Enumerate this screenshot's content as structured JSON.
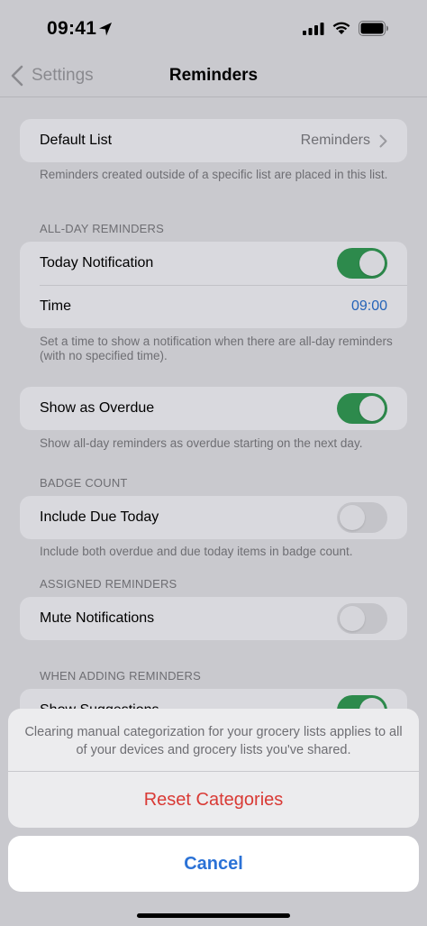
{
  "status_bar": {
    "time": "09:41"
  },
  "nav": {
    "back_label": "Settings",
    "title": "Reminders"
  },
  "default_list": {
    "label": "Default List",
    "value": "Reminders",
    "footer": "Reminders created outside of a specific list are placed in this list."
  },
  "all_day": {
    "header": "ALL-DAY REMINDERS",
    "today_notification": {
      "label": "Today Notification",
      "on": true
    },
    "time": {
      "label": "Time",
      "value": "09:00"
    },
    "footer": "Set a time to show a notification when there are all-day reminders (with no specified time)."
  },
  "overdue": {
    "label": "Show as Overdue",
    "on": true,
    "footer": "Show all-day reminders as overdue starting on the next day."
  },
  "badge": {
    "header": "BADGE COUNT",
    "label": "Include Due Today",
    "on": false,
    "footer": "Include both overdue and due today items in badge count."
  },
  "assigned": {
    "header": "ASSIGNED REMINDERS",
    "label": "Mute Notifications",
    "on": false
  },
  "when_adding": {
    "header": "WHEN ADDING REMINDERS",
    "label": "Show Suggestions",
    "on": true
  },
  "action_sheet": {
    "message": "Clearing manual categorization for your grocery lists applies to all of your devices and grocery lists you've shared.",
    "destructive_label": "Reset Categories",
    "cancel_label": "Cancel"
  },
  "colors": {
    "toggle_on": "#2d8a4c",
    "destructive": "#d93a35",
    "accent": "#2b72d6"
  }
}
